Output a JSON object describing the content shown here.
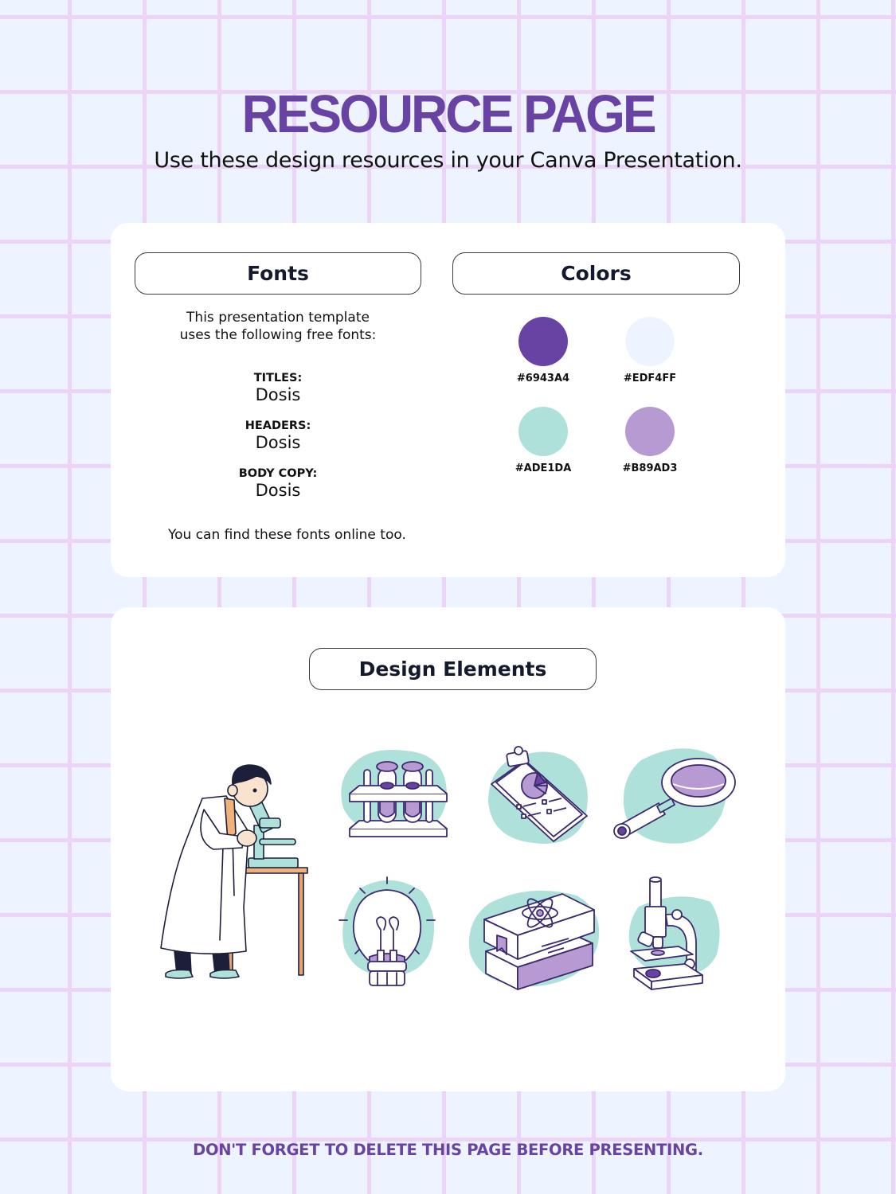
{
  "header": {
    "title": "RESOURCE PAGE",
    "subtitle": "Use these design resources in your Canva Presentation."
  },
  "fonts_section": {
    "heading": "Fonts",
    "intro_line1": "This presentation template",
    "intro_line2": "uses the following free fonts:",
    "entries": [
      {
        "label": "TITLES:",
        "font": "Dosis"
      },
      {
        "label": "HEADERS:",
        "font": "Dosis"
      },
      {
        "label": "BODY COPY:",
        "font": "Dosis"
      }
    ],
    "note": "You can find these fonts online too."
  },
  "colors_section": {
    "heading": "Colors",
    "swatches": [
      {
        "hex": "#6943A4",
        "color": "#6943A4"
      },
      {
        "hex": "#EDF4FF",
        "color": "#EDF4FF"
      },
      {
        "hex": "#ADE1DA",
        "color": "#ADE1DA"
      },
      {
        "hex": "#B89AD3",
        "color": "#B89AD3"
      }
    ]
  },
  "design_elements_section": {
    "heading": "Design Elements",
    "elements": [
      {
        "name": "scientist-with-microscope"
      },
      {
        "name": "test-tube-rack"
      },
      {
        "name": "clipboard-pie-chart"
      },
      {
        "name": "magnifying-glass"
      },
      {
        "name": "light-bulb"
      },
      {
        "name": "science-books"
      },
      {
        "name": "microscope"
      }
    ]
  },
  "footer": {
    "warning": "DON'T FORGET TO DELETE THIS PAGE BEFORE PRESENTING."
  },
  "theme": {
    "accent": "#6943A4",
    "background": "#EDF4FF",
    "teal": "#ADE1DA",
    "lavender": "#B89AD3",
    "grid_line": "#EBD4F8",
    "outline": "#3B2A6E"
  }
}
